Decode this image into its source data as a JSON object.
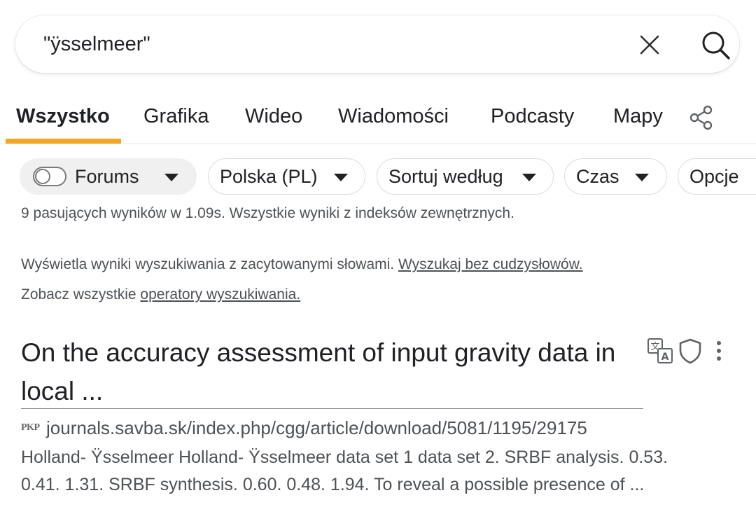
{
  "search": {
    "query": "\"ÿsselmeer\""
  },
  "tabs": [
    {
      "label": "Wszystko",
      "active": true
    },
    {
      "label": "Grafika"
    },
    {
      "label": "Wideo"
    },
    {
      "label": "Wiadomości"
    },
    {
      "label": "Podcasty"
    },
    {
      "label": "Mapy"
    }
  ],
  "accent_color": "#f5a623",
  "filters": {
    "forums_label": "Forums",
    "forums_enabled": false,
    "region_label": "Polska (PL)",
    "sort_label": "Sortuj według",
    "time_label": "Czas",
    "options_label": "Opcje"
  },
  "stats_text": "9 pasujących wyników w 1.09s. Wszystkie wyniki z indeksów zewnętrznych.",
  "quoted_notice": {
    "text": "Wyświetla wyniki wyszukiwania z zacytowanymi słowami.",
    "link": "Wyszukaj bez cudzysłowów."
  },
  "operators_notice": {
    "text": "Zobacz wszystkie",
    "link": "operatory wyszukiwania."
  },
  "result": {
    "title_line1": "On the accuracy assessment of input gravity data in",
    "title_line2": "local ...",
    "favicon_text": "PKP",
    "url": "journals.savba.sk/index.php/cgg/article/download/5081/1195/29175",
    "snippet_line1": "Holland- Ÿsselmeer Holland- Ÿsselmeer data set 1 data set 2. SRBF analysis. 0.53.",
    "snippet_line2": "0.41. 1.31. SRBF synthesis. 0.60. 0.48. 1.94. To reveal a possible presence of ..."
  }
}
